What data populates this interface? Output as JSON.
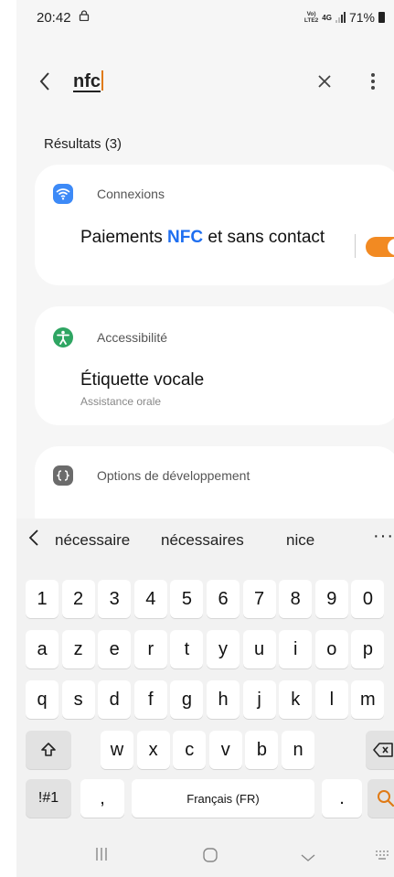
{
  "status_bar": {
    "time": "20:42",
    "network": "4G",
    "volte_top": "Vo)",
    "volte_bottom": "LTE2",
    "battery": "71%"
  },
  "search": {
    "query": "nfc",
    "back_icon": "back-chevron-icon",
    "clear_icon": "close-icon",
    "more_icon": "more-vert-icon"
  },
  "results": {
    "label": "Résultats (3)",
    "items": [
      {
        "category": "Connexions",
        "category_icon": "wifi-icon",
        "category_color": "#3d8af7",
        "title_before": "Paiements ",
        "title_highlight": "NFC",
        "title_after": " et sans contact",
        "toggle_on": true,
        "toggle_color": "#f28a22"
      },
      {
        "category": "Accessibilité",
        "category_icon": "accessibility-icon",
        "category_color": "#2ea562",
        "title": "Étiquette vocale",
        "subtitle": "Assistance orale"
      },
      {
        "category": "Options de développement",
        "category_icon": "code-braces-icon",
        "category_color": "#6b6b6b"
      }
    ]
  },
  "keyboard": {
    "suggestions": [
      "nécessaire",
      "nécessaires",
      "nice"
    ],
    "suggestion_more": "···",
    "rows": [
      [
        "1",
        "2",
        "3",
        "4",
        "5",
        "6",
        "7",
        "8",
        "9",
        "0"
      ],
      [
        "a",
        "z",
        "e",
        "r",
        "t",
        "y",
        "u",
        "i",
        "o",
        "p"
      ],
      [
        "q",
        "s",
        "d",
        "f",
        "g",
        "h",
        "j",
        "k",
        "l",
        "m"
      ],
      [
        "w",
        "x",
        "c",
        "v",
        "b",
        "n"
      ]
    ],
    "symbols_key": "!#1",
    "comma_key": ",",
    "space_key": "Français (FR)",
    "period_key": ".",
    "shift_icon": "shift-arrow-icon",
    "backspace_icon": "backspace-icon",
    "search_key_icon": "search-icon",
    "accent_color": "#e07a15"
  },
  "nav_bar": {
    "recent_icon": "recent-apps-icon",
    "home_icon": "home-icon",
    "back_icon": "nav-back-icon",
    "keyboard_icon": "keyboard-icon"
  }
}
